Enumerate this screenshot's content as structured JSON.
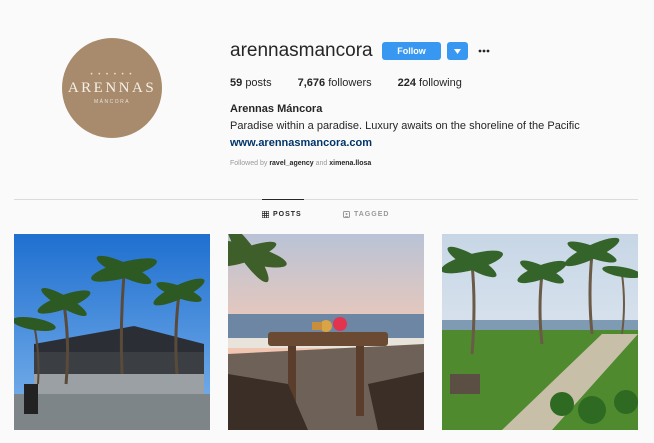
{
  "profile": {
    "username": "arennasmancora",
    "follow_label": "Follow",
    "avatar": {
      "brand": "ARENNAS",
      "sub": "MÁNCORA",
      "dots": "• • • • • •"
    },
    "stats": {
      "posts_count": "59",
      "posts_label": "posts",
      "followers_count": "7,676",
      "followers_label": "followers",
      "following_count": "224",
      "following_label": "following"
    },
    "full_name": "Arennas Máncora",
    "bio": "Paradise within a paradise. Luxury awaits on the shoreline of the Pacific",
    "website": "www.arennasmancora.com",
    "followed_by": {
      "prefix": "Followed by",
      "user1": "ravel_agency",
      "conj": "and",
      "user2": "ximena.llosa"
    }
  },
  "tabs": [
    {
      "label": "POSTS",
      "icon": "grid-icon",
      "active": true
    },
    {
      "label": "TAGGED",
      "icon": "tag-icon",
      "active": false
    }
  ],
  "posts": [
    {
      "icon": "photo-palm-building"
    },
    {
      "icon": "photo-beach-table"
    },
    {
      "icon": "photo-palm-path"
    }
  ],
  "colors": {
    "accent": "#3897f0",
    "link": "#003569",
    "text": "#262626",
    "muted": "#999999",
    "avatar_bg": "#a88b6c"
  }
}
